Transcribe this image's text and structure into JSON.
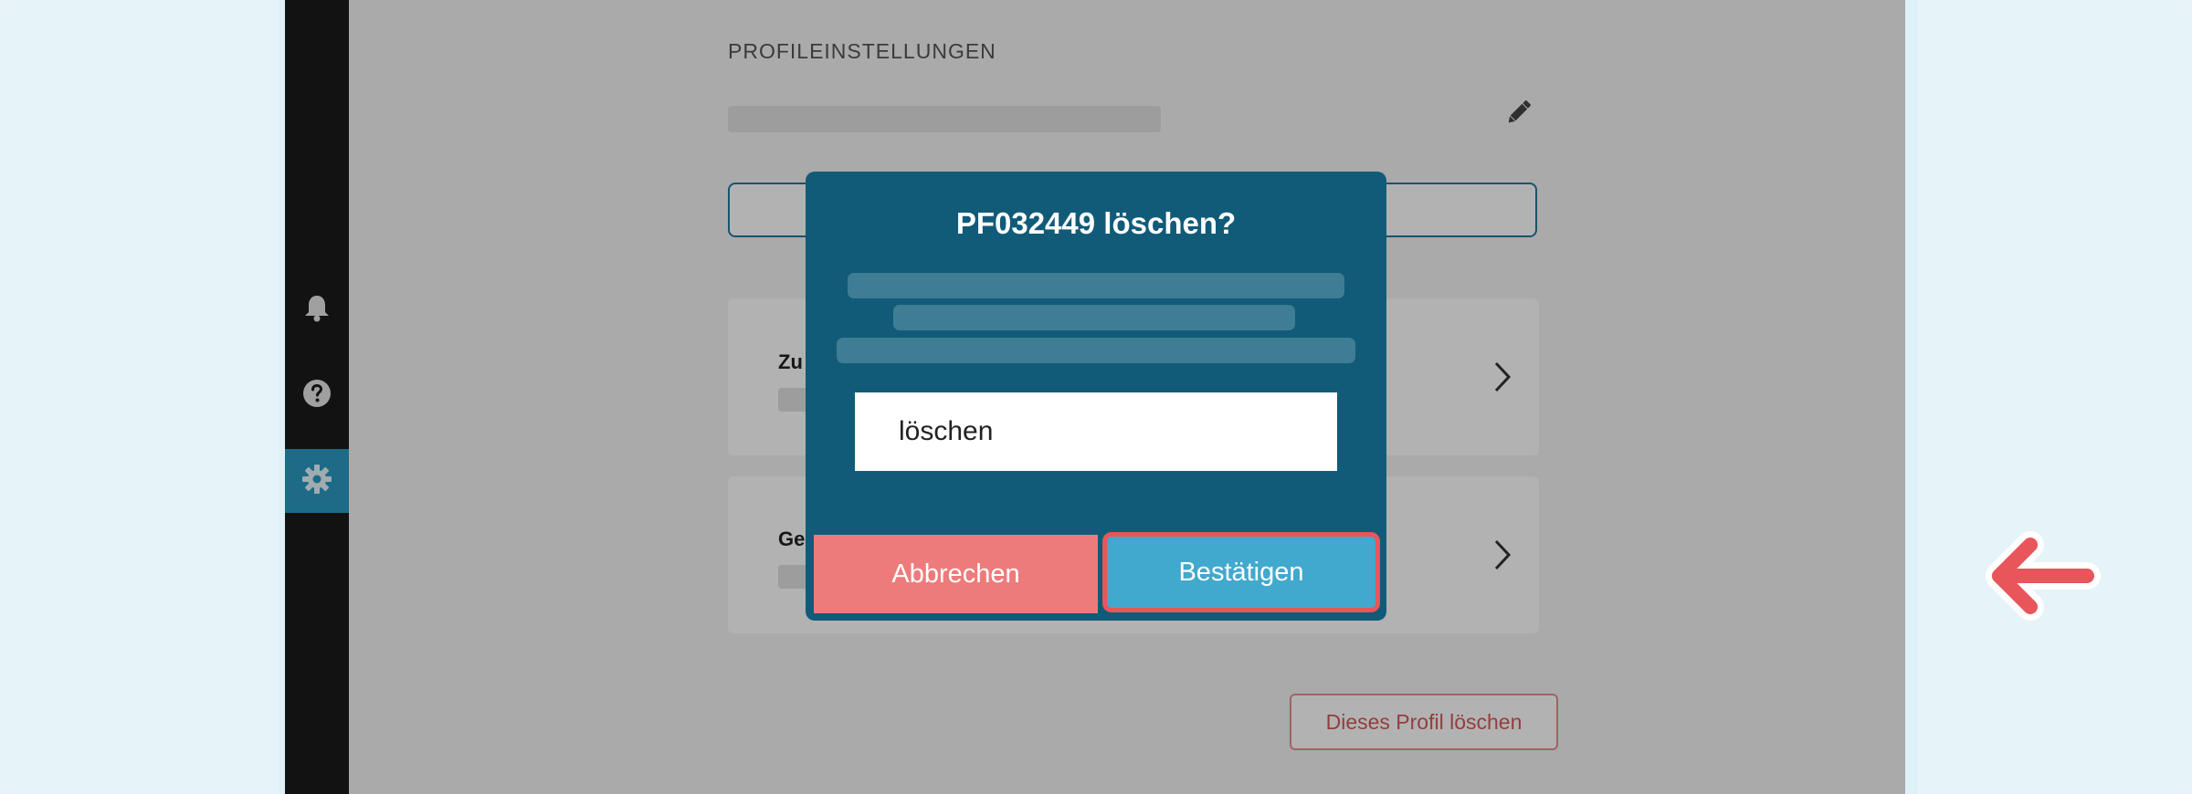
{
  "settings": {
    "section_title": "PROFILEINSTELLUNGEN",
    "card1_label_partial": "Zu",
    "card2_label_partial": "Ge",
    "delete_profile_label": "Dieses Profil löschen"
  },
  "sidebar": {
    "items": [
      {
        "icon": "bell-icon"
      },
      {
        "icon": "help-icon"
      },
      {
        "icon": "gear-icon",
        "active": true
      }
    ]
  },
  "dialog": {
    "title": "PF032449 löschen?",
    "input_value": "löschen",
    "cancel_label": "Abbrechen",
    "confirm_label": "Bestätigen"
  },
  "colors": {
    "modal_bg": "#115b78",
    "cancel_bg": "#ee7b7c",
    "confirm_bg": "#41a9cd",
    "highlight": "#e8555a"
  }
}
